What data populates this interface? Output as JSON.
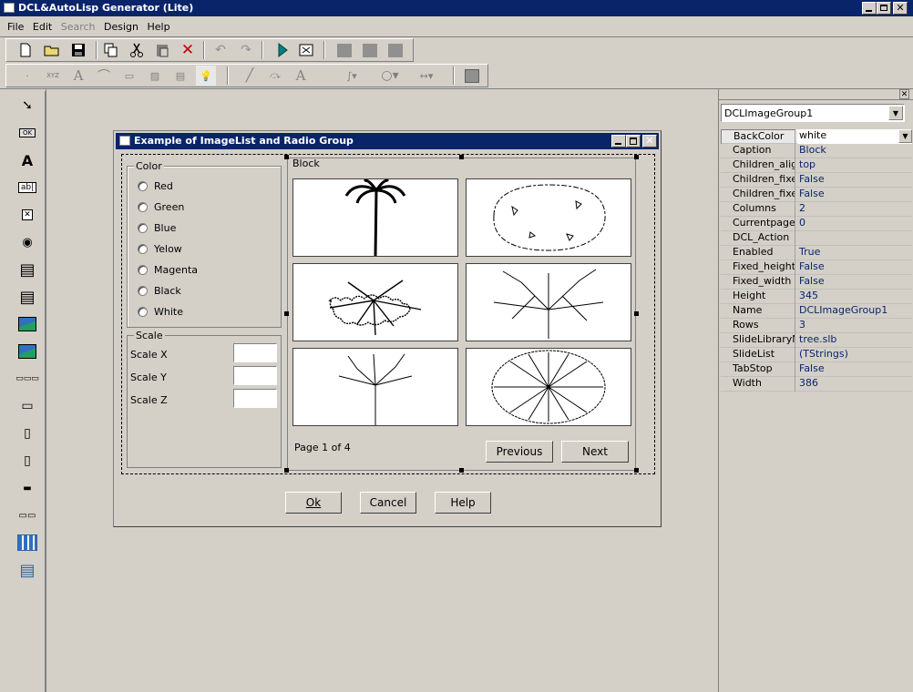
{
  "app": {
    "title": "DCL&AutoLisp Generator (Lite)"
  },
  "menu": [
    "File",
    "Edit",
    "Search",
    "Design",
    "Help"
  ],
  "toolbar1": [
    "new-icon",
    "open-icon",
    "save-icon",
    "copy-icon",
    "cut-icon",
    "paste-icon",
    "delete-icon",
    "undo-icon",
    "redo-icon",
    "run-icon",
    "preview-icon",
    "block-icon",
    "block-icon",
    "block-icon"
  ],
  "palette": [
    "pointer-icon",
    "ok-button-icon",
    "text-icon",
    "edit-box-icon",
    "toggle-icon",
    "radio-icon",
    "list-icon",
    "popup-list-icon",
    "image-icon",
    "image-button-icon",
    "row-icon",
    "column-icon",
    "slider-icon",
    "boxed-icon",
    "spacer-icon",
    "concatenation-icon",
    "image-group-icon",
    "paragraph-icon"
  ],
  "dialog": {
    "title": "Example of ImageList and Radio Group",
    "color_group": "Color",
    "colors": [
      "Red",
      "Green",
      "Blue",
      "Yelow",
      "Magenta",
      "Black",
      "White"
    ],
    "scale_group": "Scale",
    "scale_labels": [
      "Scale X",
      "Scale Y",
      "Scale Z"
    ],
    "block_group": "Block",
    "page_text": "Page 1 of 4",
    "previous": "Previous",
    "next": "Next",
    "ok": "Ok",
    "cancel": "Cancel",
    "help": "Help"
  },
  "inspector": {
    "component": "DCLImageGroup1",
    "properties": [
      {
        "k": "BackColor",
        "v": "white"
      },
      {
        "k": "Caption",
        "v": "Block"
      },
      {
        "k": "Children_alignm",
        "v": "top"
      },
      {
        "k": "Children_fixed_",
        "v": "False"
      },
      {
        "k": "Children_fixed_",
        "v": "False"
      },
      {
        "k": "Columns",
        "v": "2"
      },
      {
        "k": "Currentpage",
        "v": "0"
      },
      {
        "k": "DCL_Action",
        "v": ""
      },
      {
        "k": "Enabled",
        "v": "True"
      },
      {
        "k": "Fixed_height",
        "v": "False"
      },
      {
        "k": "Fixed_width",
        "v": "False"
      },
      {
        "k": "Height",
        "v": "345"
      },
      {
        "k": "Name",
        "v": "DCLImageGroup1"
      },
      {
        "k": "Rows",
        "v": "3"
      },
      {
        "k": "SlideLibraryNa",
        "v": "tree.slb"
      },
      {
        "k": "SlideList",
        "v": "(TStrings)"
      },
      {
        "k": "TabStop",
        "v": "False"
      },
      {
        "k": "Width",
        "v": "386"
      }
    ]
  }
}
